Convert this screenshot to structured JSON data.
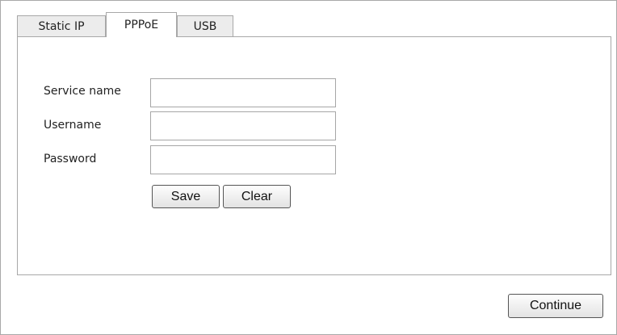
{
  "tabs": [
    {
      "label": "Static IP",
      "active": false
    },
    {
      "label": "PPPoE",
      "active": true
    },
    {
      "label": "USB",
      "active": false
    }
  ],
  "form": {
    "service_name": {
      "label": "Service name",
      "value": ""
    },
    "username": {
      "label": "Username",
      "value": ""
    },
    "password": {
      "label": "Password",
      "value": ""
    }
  },
  "buttons": {
    "save": "Save",
    "clear": "Clear",
    "continue": "Continue"
  },
  "colors": {
    "border": "#a8a8a8",
    "inactive_tab": "#ececec",
    "background": "#ffffff"
  }
}
